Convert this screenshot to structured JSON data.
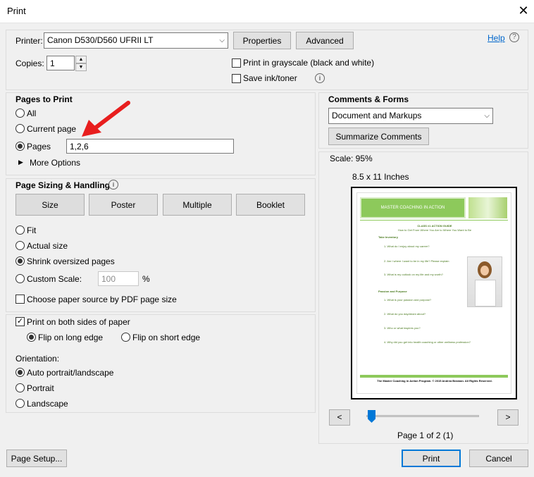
{
  "window": {
    "title": "Print",
    "close_glyph": "✕"
  },
  "printer": {
    "label": "Printer:",
    "selected": "Canon D530/D560 UFRII LT",
    "properties_button": "Properties",
    "advanced_button": "Advanced",
    "help_link": "Help",
    "copies_label": "Copies:",
    "copies_value": "1",
    "grayscale_label": "Print in grayscale (black and white)",
    "grayscale_checked": false,
    "save_ink_label": "Save ink/toner",
    "save_ink_checked": false
  },
  "pages_to_print": {
    "heading": "Pages to Print",
    "all_label": "All",
    "current_label": "Current page",
    "pages_label": "Pages",
    "pages_value": "1,2,6",
    "selected": "pages",
    "more_options": "More Options"
  },
  "sizing": {
    "heading": "Page Sizing & Handling",
    "tabs": [
      "Size",
      "Poster",
      "Multiple",
      "Booklet"
    ],
    "fit_label": "Fit",
    "actual_label": "Actual size",
    "shrink_label": "Shrink oversized pages",
    "custom_label": "Custom Scale:",
    "custom_value": "100",
    "percent": "%",
    "selected": "shrink",
    "paper_source_label": "Choose paper source by PDF page size"
  },
  "duplex": {
    "both_sides_label": "Print on both sides of paper",
    "both_sides_checked": true,
    "flip_long_label": "Flip on long edge",
    "flip_short_label": "Flip on short edge",
    "selected": "long"
  },
  "orientation": {
    "heading": "Orientation:",
    "auto_label": "Auto portrait/landscape",
    "portrait_label": "Portrait",
    "landscape_label": "Landscape",
    "selected": "auto"
  },
  "comments": {
    "heading": "Comments & Forms",
    "selected": "Document and Markups",
    "summarize_button": "Summarize Comments"
  },
  "preview": {
    "scale_text": "Scale:  95%",
    "paper_size": "8.5 x 11 Inches",
    "page_indicator": "Page 1 of 2 (1)",
    "prev_glyph": "<",
    "next_glyph": ">",
    "slider_fraction": 0.0,
    "doc": {
      "banner": "MASTER COACHING IN ACTION",
      "heading": "CLASS #1 ACTION GUIDE",
      "subheading": "How to Get From Where You Are to Where You Want to Be",
      "section1": "Take Inventory",
      "q1": "1.   What do I enjoy about my career?",
      "q2": "2.   Am I where I want to be in my life?  Please explain",
      "q3": "3.   What is my outlook on my life and my worth?",
      "section2": "Passion and Purpose",
      "q4": "1.   What is your passion and purpose?",
      "q5": "2.   What do you daydream about?",
      "q6": "3.   Who or what inspires you?",
      "q7": "4.   Why did you get into health coaching or other wellness profession?",
      "footer": "The Master Coaching in Action Program. © 2015 Andrea Beaman. All Rights Reserved."
    }
  },
  "footer": {
    "page_setup_button": "Page Setup...",
    "print_button": "Print",
    "cancel_button": "Cancel"
  },
  "colors": {
    "arrow": "#e81e1e",
    "link": "#0066cc",
    "banner_green": "#8dc95b",
    "doc_text_green": "#4a7a1f"
  }
}
